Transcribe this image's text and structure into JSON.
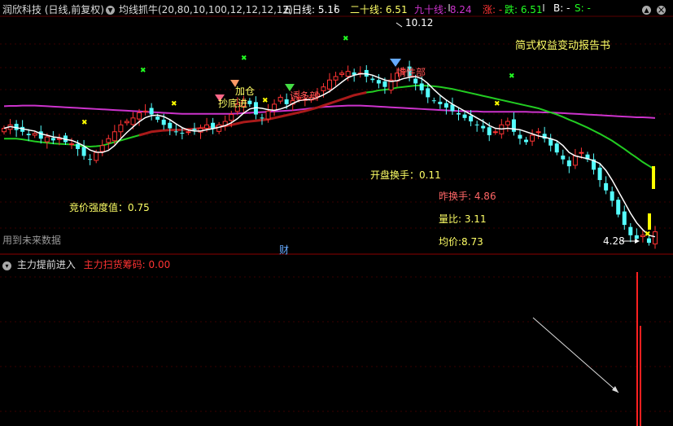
{
  "header": {
    "stock": "润欣科技 (日线,前复权)",
    "indicator": "均线抓牛(20,80,10,100,12,12,12,12)",
    "ma5": "五日线: 5.16",
    "ma20": "二十线: 6.51",
    "ma90": "九十线: 8.24",
    "rise": "涨: -",
    "fall": "跌: 6.51",
    "b": "B: -",
    "s": "S: -"
  },
  "annotations": {
    "report": "简式权益变动报告书",
    "add_pos": "加仓",
    "bottom_buy": "抄底进",
    "lure": "诱多部",
    "inertia": "惰性部",
    "bid_strength": "竞价强度值：0.75",
    "open_turnover": "开盘换手：0.11",
    "prev_turnover": "昨换手: 4.86",
    "volume_ratio": "量比: 3.11",
    "avg_price": "均价:8.73",
    "future_data": "用到未来数据",
    "finance": "财",
    "high_label": "10.12",
    "low_label": "4.28"
  },
  "sub": {
    "name": "主力提前进入",
    "value": "主力扫货筹码: 0.00"
  },
  "colors": {
    "up": "#ff3333",
    "down": "#54ffff",
    "ma5": "#ffffff",
    "ma20": "#22cc22",
    "ma90": "#cc33cc",
    "thick": "#aa1a1a",
    "yellow": "#ffff00",
    "bar": "#ff2020"
  },
  "chart_data": {
    "type": "candlestick",
    "price_range": [
      4.0,
      10.8
    ],
    "high": 10.12,
    "low": 4.28,
    "closes": [
      7.6,
      7.7,
      7.55,
      7.5,
      7.4,
      7.45,
      7.3,
      7.35,
      7.25,
      7.3,
      7.2,
      7.15,
      7.0,
      6.8,
      6.7,
      6.9,
      7.1,
      7.3,
      7.5,
      7.7,
      7.8,
      7.9,
      8.05,
      8.1,
      8.0,
      7.85,
      7.7,
      7.6,
      7.5,
      7.45,
      7.5,
      7.55,
      7.6,
      7.7,
      7.6,
      7.7,
      7.8,
      8.0,
      8.3,
      8.4,
      8.3,
      8.0,
      7.9,
      8.1,
      8.3,
      8.5,
      8.3,
      8.4,
      8.5,
      8.45,
      8.5,
      8.6,
      8.8,
      9.0,
      9.1,
      9.2,
      9.25,
      9.15,
      9.2,
      9.1,
      9.0,
      8.9,
      8.8,
      9.0,
      9.2,
      9.3,
      9.1,
      8.9,
      8.7,
      8.5,
      8.4,
      8.3,
      8.2,
      8.1,
      8.0,
      7.9,
      7.8,
      7.7,
      7.6,
      7.4,
      7.5,
      7.7,
      7.8,
      7.5,
      7.3,
      7.2,
      7.4,
      7.5,
      7.3,
      7.1,
      6.9,
      6.7,
      6.5,
      6.8,
      6.9,
      6.7,
      6.4,
      6.1,
      5.8,
      5.5,
      5.1,
      4.8,
      4.5,
      4.4,
      4.5,
      4.28,
      4.6
    ],
    "ma20": [
      7.3,
      7.3,
      7.3,
      7.28,
      7.25,
      7.22,
      7.2,
      7.18,
      7.16,
      7.15,
      7.14,
      7.13,
      7.1,
      7.08,
      7.07,
      7.08,
      7.1,
      7.15,
      7.2,
      7.25,
      7.3,
      7.35,
      7.4,
      7.45,
      7.5,
      7.52,
      7.54,
      7.55,
      7.55,
      7.56,
      7.57,
      7.58,
      7.6,
      7.62,
      7.63,
      7.65,
      7.67,
      7.7,
      7.74,
      7.78,
      7.8,
      7.82,
      7.84,
      7.86,
      7.9,
      7.94,
      7.98,
      8.02,
      8.06,
      8.1,
      8.15,
      8.2,
      8.26,
      8.32,
      8.38,
      8.44,
      8.5,
      8.56,
      8.6,
      8.64,
      8.66,
      8.7,
      8.72,
      8.74,
      8.78,
      8.8,
      8.82,
      8.84,
      8.84,
      8.83,
      8.82,
      8.8,
      8.77,
      8.74,
      8.7,
      8.66,
      8.62,
      8.58,
      8.54,
      8.5,
      8.46,
      8.42,
      8.38,
      8.34,
      8.3,
      8.26,
      8.22,
      8.18,
      8.12,
      8.06,
      8.0,
      7.93,
      7.85,
      7.78,
      7.7,
      7.62,
      7.53,
      7.44,
      7.34,
      7.24,
      7.12,
      7.0,
      6.87,
      6.75,
      6.62,
      6.51,
      6.4
    ],
    "ma90": [
      8.24,
      8.25,
      8.25,
      8.26,
      8.26,
      8.26,
      8.25,
      8.24,
      8.23,
      8.22,
      8.21,
      8.2,
      8.19,
      8.18,
      8.17,
      8.16,
      8.15,
      8.14,
      8.13,
      8.12,
      8.11,
      8.1,
      8.09,
      8.08,
      8.07,
      8.06,
      8.05,
      8.04,
      8.03,
      8.02,
      8.02,
      8.02,
      8.02,
      8.02,
      8.02,
      8.02,
      8.02,
      8.02,
      8.03,
      8.04,
      8.05,
      8.06,
      8.07,
      8.08,
      8.09,
      8.1,
      8.11,
      8.12,
      8.14,
      8.16,
      8.18,
      8.2,
      8.22,
      8.23,
      8.24,
      8.25,
      8.26,
      8.26,
      8.26,
      8.25,
      8.24,
      8.23,
      8.22,
      8.21,
      8.2,
      8.19,
      8.18,
      8.17,
      8.16,
      8.15,
      8.14,
      8.13,
      8.12,
      8.11,
      8.1,
      8.1,
      8.09,
      8.09,
      8.08,
      8.08,
      8.08,
      8.08,
      8.08,
      8.08,
      8.08,
      8.08,
      8.07,
      8.07,
      8.06,
      8.06,
      8.05,
      8.04,
      8.03,
      8.02,
      8.01,
      8.0,
      7.99,
      7.98,
      7.97,
      7.96,
      7.95,
      7.94,
      7.93,
      7.92,
      7.92,
      7.91,
      7.9
    ]
  }
}
